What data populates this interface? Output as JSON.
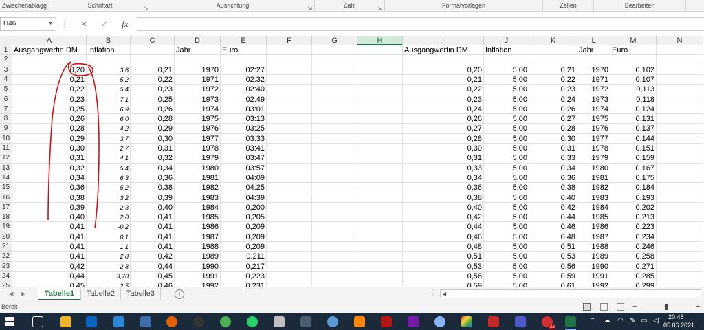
{
  "ribbon": {
    "groups": [
      {
        "label": "Zwischenablage"
      },
      {
        "label": "Schriftart"
      },
      {
        "label": "Ausrichtung"
      },
      {
        "label": "Zahl"
      },
      {
        "label": "Formatvorlagen"
      },
      {
        "label": "Zellen"
      },
      {
        "label": "Bearbeiten"
      }
    ]
  },
  "formula_bar": {
    "name_box": "H46",
    "fx_label": "fx",
    "formula": ""
  },
  "columns": [
    "A",
    "B",
    "C",
    "D",
    "E",
    "F",
    "G",
    "H",
    "I",
    "J",
    "K",
    "L",
    "M",
    "N"
  ],
  "selected_column": "H",
  "headers_row1": {
    "A": "Ausgangwertin DM",
    "B": "Inflation",
    "D": "Jahr",
    "E": "Euro",
    "I": "Ausgangwertin DM",
    "J": "Inflation",
    "L": "Jahr",
    "M": "Euro"
  },
  "rows": [
    {
      "n": "1"
    },
    {
      "n": "2"
    },
    {
      "n": "3",
      "A": "0,20",
      "B": "3,6",
      "C": "0,21",
      "D": "1970",
      "E": "02:27",
      "I": "0,20",
      "J": "5,00",
      "K": "0,21",
      "L": "1970",
      "M": "0,102"
    },
    {
      "n": "4",
      "A": "0,21",
      "B": "5,2",
      "C": "0,22",
      "D": "1971",
      "E": "02:32",
      "I": "0,21",
      "J": "5,00",
      "K": "0,22",
      "L": "1971",
      "M": "0,107"
    },
    {
      "n": "5",
      "A": "0,22",
      "B": "5,4",
      "C": "0,23",
      "D": "1972",
      "E": "02:40",
      "I": "0,22",
      "J": "5,00",
      "K": "0,23",
      "L": "1972",
      "M": "0,113"
    },
    {
      "n": "6",
      "A": "0,23",
      "B": "7,1",
      "C": "0,25",
      "D": "1973",
      "E": "02:49",
      "I": "0,23",
      "J": "5,00",
      "K": "0,24",
      "L": "1973",
      "M": "0,118"
    },
    {
      "n": "7",
      "A": "0,25",
      "B": "6,9",
      "C": "0,26",
      "D": "1974",
      "E": "03:01",
      "I": "0,24",
      "J": "5,00",
      "K": "0,26",
      "L": "1974",
      "M": "0,124"
    },
    {
      "n": "8",
      "A": "0,26",
      "B": "6,0",
      "C": "0,28",
      "D": "1975",
      "E": "03:13",
      "I": "0,26",
      "J": "5,00",
      "K": "0,27",
      "L": "1975",
      "M": "0,131"
    },
    {
      "n": "9",
      "A": "0,28",
      "B": "4,2",
      "C": "0,29",
      "D": "1976",
      "E": "03:25",
      "I": "0,27",
      "J": "5,00",
      "K": "0,28",
      "L": "1976",
      "M": "0,137"
    },
    {
      "n": "10",
      "A": "0,29",
      "B": "3,7",
      "C": "0,30",
      "D": "1977",
      "E": "03:33",
      "I": "0,28",
      "J": "5,00",
      "K": "0,30",
      "L": "1977",
      "M": "0,144"
    },
    {
      "n": "11",
      "A": "0,30",
      "B": "2,7",
      "C": "0,31",
      "D": "1978",
      "E": "03:41",
      "I": "0,30",
      "J": "5,00",
      "K": "0,31",
      "L": "1978",
      "M": "0,151"
    },
    {
      "n": "12",
      "A": "0,31",
      "B": "4,1",
      "C": "0,32",
      "D": "1979",
      "E": "03:47",
      "I": "0,31",
      "J": "5,00",
      "K": "0,33",
      "L": "1979",
      "M": "0,159"
    },
    {
      "n": "13",
      "A": "0,32",
      "B": "5,4",
      "C": "0,34",
      "D": "1980",
      "E": "03:57",
      "I": "0,33",
      "J": "5,00",
      "K": "0,34",
      "L": "1980",
      "M": "0,167"
    },
    {
      "n": "14",
      "A": "0,34",
      "B": "6,3",
      "C": "0,36",
      "D": "1981",
      "E": "04:09",
      "I": "0,34",
      "J": "5,00",
      "K": "0,36",
      "L": "1981",
      "M": "0,175"
    },
    {
      "n": "15",
      "A": "0,36",
      "B": "5,2",
      "C": "0,38",
      "D": "1982",
      "E": "04:25",
      "I": "0,36",
      "J": "5,00",
      "K": "0,38",
      "L": "1982",
      "M": "0,184"
    },
    {
      "n": "16",
      "A": "0,38",
      "B": "3,2",
      "C": "0,39",
      "D": "1983",
      "E": "04:39",
      "I": "0,38",
      "J": "5,00",
      "K": "0,40",
      "L": "1983",
      "M": "0,193"
    },
    {
      "n": "17",
      "A": "0,39",
      "B": "2,3",
      "C": "0,40",
      "D": "1984",
      "E": "0,200",
      "I": "0,40",
      "J": "5,00",
      "K": "0,42",
      "L": "1984",
      "M": "0,202"
    },
    {
      "n": "18",
      "A": "0,40",
      "B": "2,0",
      "C": "0,41",
      "D": "1985",
      "E": "0,205",
      "I": "0,42",
      "J": "5,00",
      "K": "0,44",
      "L": "1985",
      "M": "0,213"
    },
    {
      "n": "19",
      "A": "0,41",
      "B": "-0,2",
      "C": "0,41",
      "D": "1986",
      "E": "0,209",
      "I": "0,44",
      "J": "5,00",
      "K": "0,46",
      "L": "1986",
      "M": "0,223"
    },
    {
      "n": "20",
      "A": "0,41",
      "B": "0,1",
      "C": "0,41",
      "D": "1987",
      "E": "0,209",
      "I": "0,46",
      "J": "5,00",
      "K": "0,48",
      "L": "1987",
      "M": "0,234"
    },
    {
      "n": "21",
      "A": "0,41",
      "B": "1,1",
      "C": "0,41",
      "D": "1988",
      "E": "0,209",
      "I": "0,48",
      "J": "5,00",
      "K": "0,51",
      "L": "1988",
      "M": "0,246"
    },
    {
      "n": "22",
      "A": "0,41",
      "B": "2,8",
      "C": "0,42",
      "D": "1989",
      "E": "0,211",
      "I": "0,51",
      "J": "5,00",
      "K": "0,53",
      "L": "1989",
      "M": "0,258"
    },
    {
      "n": "23",
      "A": "0,42",
      "B": "2,8",
      "C": "0,44",
      "D": "1990",
      "E": "0,217",
      "I": "0,53",
      "J": "5,00",
      "K": "0,56",
      "L": "1990",
      "M": "0,271"
    },
    {
      "n": "24",
      "A": "0,44",
      "B": "3,70",
      "C": "0,45",
      "D": "1991",
      "E": "0,223",
      "I": "0,56",
      "J": "5,00",
      "K": "0,59",
      "L": "1991",
      "M": "0,285"
    },
    {
      "n": "25",
      "A": "0,45",
      "B": "2,5",
      "C": "0,46",
      "D": "1992",
      "E": "0,231",
      "I": "0,59",
      "J": "5,00",
      "K": "0,61",
      "L": "1992",
      "M": "0,299"
    }
  ],
  "sheet_tabs": [
    "Tabelle1",
    "Tabelle2",
    "Tabelle3"
  ],
  "active_tab": "Tabelle1",
  "status": {
    "text": "Bereit"
  },
  "taskbar": {
    "time": "20:46",
    "date": "05.06.2021",
    "badge": "32"
  },
  "colors": {
    "excel_green": "#217346",
    "annotation_red": "#d01010"
  }
}
